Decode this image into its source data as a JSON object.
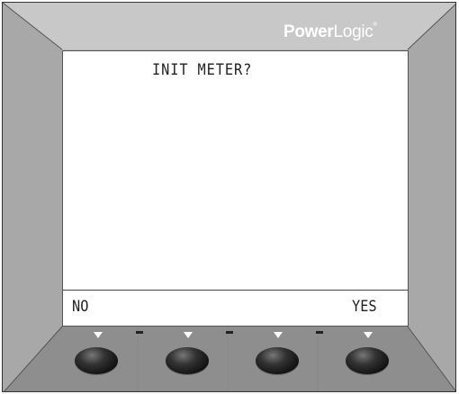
{
  "brand": {
    "name_bold": "Power",
    "name_light": "Logic",
    "mark": "®"
  },
  "display": {
    "message": "INIT METER?",
    "softkeys": {
      "left_label": "NO",
      "right_label": "YES"
    }
  },
  "colors": {
    "housing": "#b3b3b3",
    "screen": "#ffffff",
    "button": "#1a1a1a",
    "text": "#222222"
  },
  "buttons": [
    {
      "name": "softkey-1-button"
    },
    {
      "name": "softkey-2-button"
    },
    {
      "name": "softkey-3-button"
    },
    {
      "name": "softkey-4-button"
    }
  ]
}
